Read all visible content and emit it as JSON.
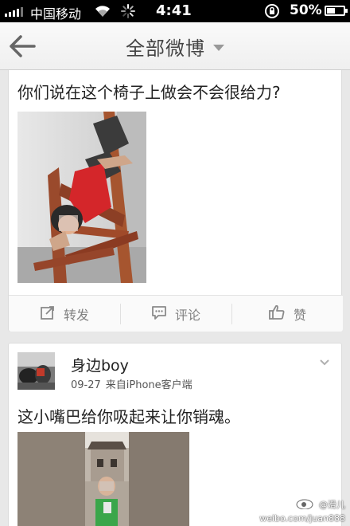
{
  "status_bar": {
    "carrier": "中国移动",
    "time": "4:41",
    "battery": "50%",
    "battery_level": 0.5
  },
  "nav": {
    "title": "全部微博",
    "back_icon": "back-arrow-icon",
    "dropdown_icon": "caret-down-icon"
  },
  "posts": [
    {
      "text": "你们说在这个椅子上做会不会很给力?",
      "actions": [
        {
          "label": "转发",
          "icon": "repost-icon"
        },
        {
          "label": "评论",
          "icon": "comment-icon"
        },
        {
          "label": "赞",
          "icon": "thumbs-up-icon"
        }
      ]
    },
    {
      "username": "身边boy",
      "date": "09-27",
      "source": "来自iPhone客户端",
      "text": "这小嘴巴给你吸起来让你销魂。"
    }
  ],
  "watermark": {
    "handle": "@滑儿",
    "url": "weibo.com/juan888"
  },
  "colors": {
    "status_bar_bg": "#000000",
    "page_bg": "#e8e8e8",
    "action_text": "#808080"
  }
}
